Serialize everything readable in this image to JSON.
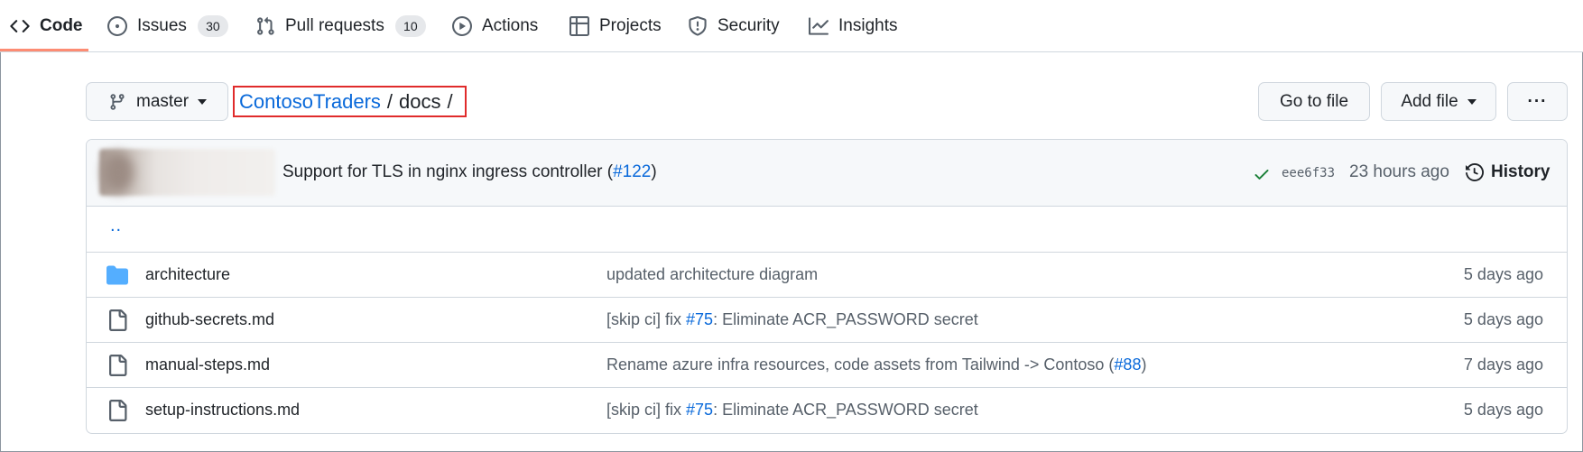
{
  "nav": {
    "tabs": [
      {
        "label": "Code",
        "icon": "code-icon",
        "selected": true
      },
      {
        "label": "Issues",
        "icon": "issue-opened-icon",
        "count": "30"
      },
      {
        "label": "Pull requests",
        "icon": "git-pull-request-icon",
        "count": "10"
      },
      {
        "label": "Actions",
        "icon": "play-icon"
      },
      {
        "label": "Projects",
        "icon": "table-icon"
      },
      {
        "label": "Security",
        "icon": "shield-icon"
      },
      {
        "label": "Insights",
        "icon": "graph-icon"
      }
    ],
    "accent": "#fd8c73"
  },
  "toolbar": {
    "branch": "master",
    "breadcrumb": {
      "repo": "ContosoTraders",
      "sep1": "/",
      "folder": "docs",
      "sep2": "/"
    },
    "go_to_file": "Go to file",
    "add_file": "Add file",
    "more": "···"
  },
  "latest_commit": {
    "message": "Support for TLS in nginx ingress controller (",
    "pr": "#122",
    "message_end": ")",
    "sha": "eee6f33",
    "time": "23 hours ago",
    "history": "History",
    "status": "success",
    "status_color": "#1a7f37"
  },
  "files": {
    "parent": "..",
    "rows": [
      {
        "type": "folder",
        "name": "architecture",
        "msg_pre": "updated architecture diagram",
        "link": "",
        "msg_post": "",
        "age": "5 days ago"
      },
      {
        "type": "file",
        "name": "github-secrets.md",
        "msg_pre": "[skip ci] fix ",
        "link": "#75",
        "msg_post": ": Eliminate ACR_PASSWORD secret",
        "age": "5 days ago"
      },
      {
        "type": "file",
        "name": "manual-steps.md",
        "msg_pre": "Rename azure infra resources, code assets from Tailwind -> Contoso (",
        "link": "#88",
        "msg_post": ")",
        "age": "7 days ago"
      },
      {
        "type": "file",
        "name": "setup-instructions.md",
        "msg_pre": "[skip ci] fix ",
        "link": "#75",
        "msg_post": ": Eliminate ACR_PASSWORD secret",
        "age": "5 days ago"
      }
    ]
  },
  "colors": {
    "link": "#0969da",
    "folder": "#54aeff",
    "highlight_box": "#e02b2b"
  }
}
